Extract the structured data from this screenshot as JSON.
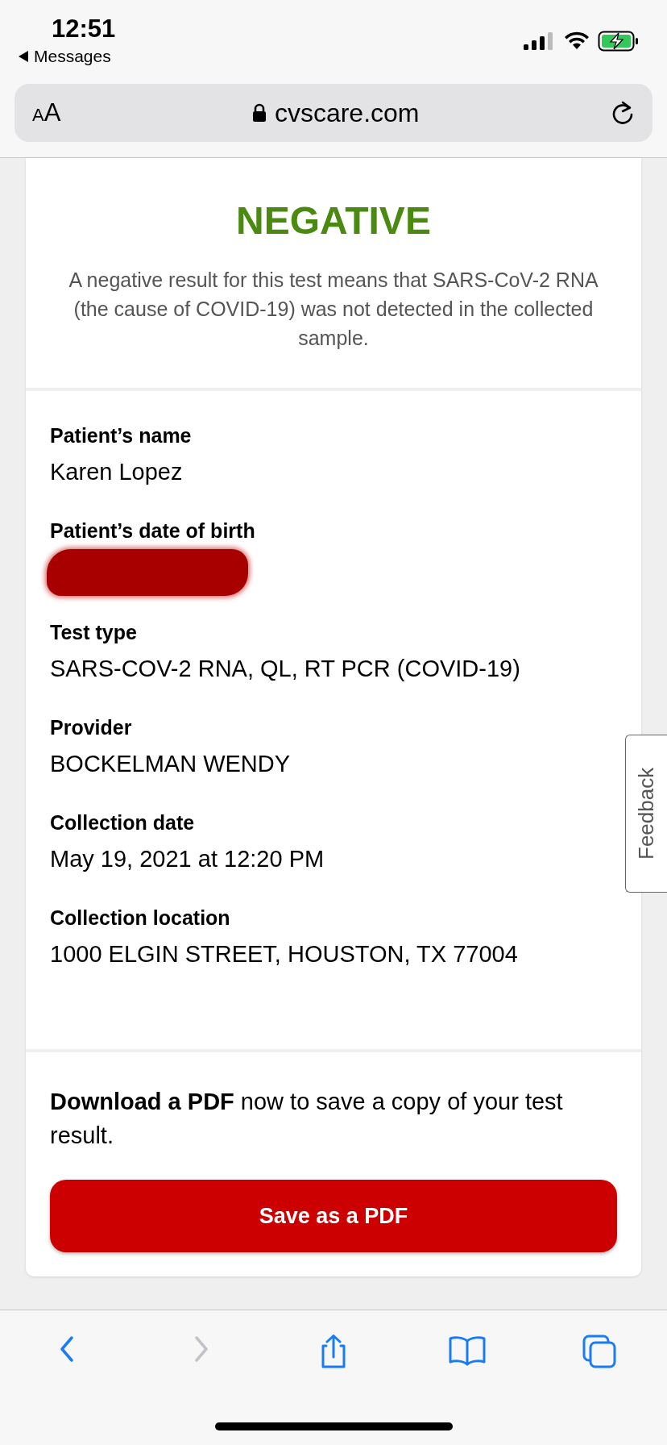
{
  "status_bar": {
    "time": "12:51",
    "back_label": "Messages"
  },
  "address_bar": {
    "text_size_button": "AA",
    "url": "cvscare.com"
  },
  "result": {
    "title": "NEGATIVE",
    "description": "A negative result for this test means that SARS-CoV-2 RNA (the cause of COVID-19) was not detected in the collected sample."
  },
  "fields": [
    {
      "label": "Patient’s name",
      "value": "Karen Lopez",
      "redacted": false
    },
    {
      "label": "Patient’s date of birth",
      "redacted": true
    },
    {
      "label": "Test type",
      "value": "SARS-COV-2 RNA, QL, RT PCR (COVID-19)",
      "redacted": false
    },
    {
      "label": "Provider",
      "value": "BOCKELMAN WENDY",
      "redacted": false
    },
    {
      "label": "Collection date",
      "value": "May 19, 2021 at 12:20 PM",
      "redacted": false
    },
    {
      "label": "Collection location",
      "value": "1000 ELGIN STREET, HOUSTON, TX 77004",
      "redacted": false
    }
  ],
  "download": {
    "text": "**Download a PDF** now to save a copy of your test result.",
    "button": "Save as a PDF"
  },
  "feedback_tab": "Feedback",
  "toolbar": [
    {
      "kind": "back",
      "disabled": false
    },
    {
      "kind": "forward",
      "disabled": true
    },
    {
      "kind": "share",
      "disabled": false
    },
    {
      "kind": "bookmarks",
      "disabled": false
    },
    {
      "kind": "tabs",
      "disabled": false
    }
  ]
}
